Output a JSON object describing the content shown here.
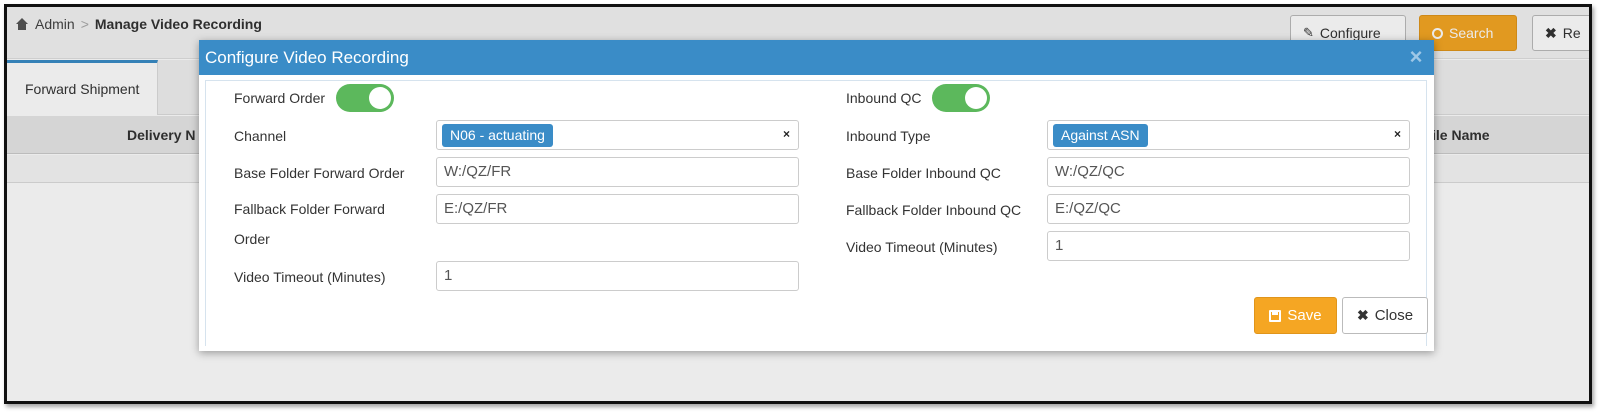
{
  "breadcrumb": {
    "root": "Admin",
    "separator": ">",
    "current": "Manage Video Recording"
  },
  "toolbar": {
    "configure_label": "Configure",
    "search_label": "Search",
    "reset_label": "Re"
  },
  "tabs": [
    {
      "label": "Forward Shipment",
      "active": true
    }
  ],
  "grid": {
    "columns": [
      "Delivery N",
      "ile Name"
    ]
  },
  "modal": {
    "title": "Configure Video Recording",
    "close_glyph": "×",
    "forward": {
      "toggle_label": "Forward Order",
      "toggle_on": true,
      "channel_label": "Channel",
      "channel_value": "N06 - actuating",
      "base_folder_label": "Base Folder Forward Order",
      "base_folder_value": "W:/QZ/FR",
      "fallback_folder_label": "Fallback Folder Forward Order",
      "fallback_folder_value": "E:/QZ/FR",
      "timeout_label": "Video Timeout (Minutes)",
      "timeout_value": "1"
    },
    "inbound": {
      "toggle_label": "Inbound QC",
      "toggle_on": true,
      "type_label": "Inbound Type",
      "type_value": "Against ASN",
      "base_folder_label": "Base Folder Inbound QC",
      "base_folder_value": "W:/QZ/QC",
      "fallback_folder_label": "Fallback Folder Inbound QC",
      "fallback_folder_value": "E:/QZ/QC",
      "timeout_label": "Video Timeout (Minutes)",
      "timeout_value": "1"
    },
    "clear_glyph": "×",
    "save_label": "Save",
    "close_label": "Close"
  },
  "colors": {
    "header_blue": "#3a8cc7",
    "toggle_green": "#5cb85c",
    "save_orange": "#f5a623"
  }
}
